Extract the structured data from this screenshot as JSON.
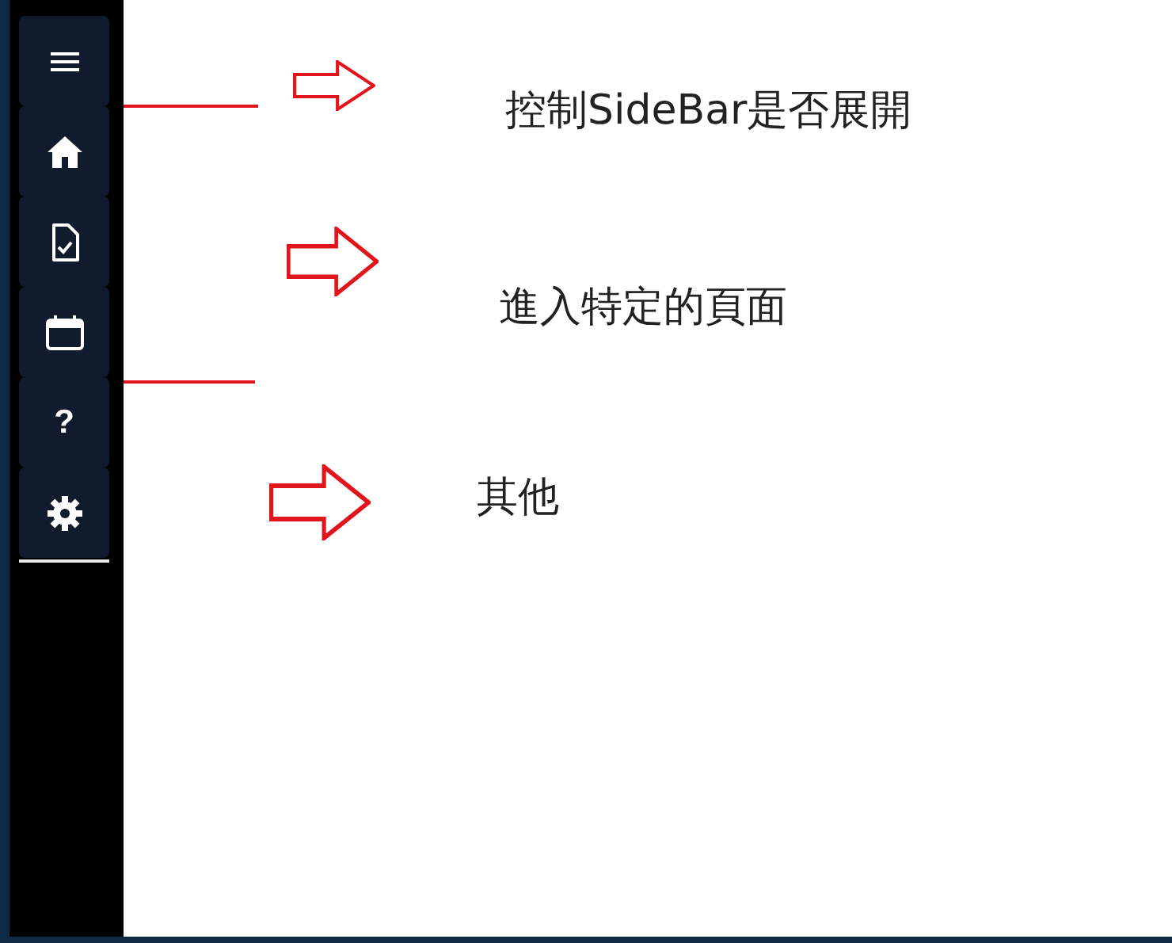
{
  "sidebar": {
    "items": [
      {
        "kind": "menu"
      },
      {
        "kind": "home"
      },
      {
        "kind": "document"
      },
      {
        "kind": "calendar"
      },
      {
        "kind": "help",
        "label": "?"
      },
      {
        "kind": "settings"
      }
    ]
  },
  "annotations": {
    "lines": [
      {
        "kind": "line"
      },
      {
        "kind": "line"
      }
    ],
    "notes": [
      {
        "text": "控制SideBar是否展開"
      },
      {
        "text": "進入特定的頁面"
      },
      {
        "text": "其他"
      }
    ]
  }
}
